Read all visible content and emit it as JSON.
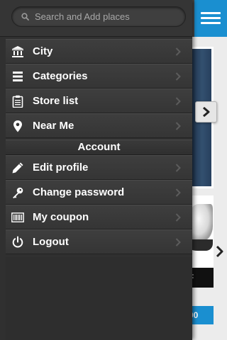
{
  "search": {
    "placeholder": "Search and Add places"
  },
  "menu": {
    "items": [
      {
        "label": "City",
        "icon": "bank-building-icon"
      },
      {
        "label": "Categories",
        "icon": "list-icon"
      },
      {
        "label": "Store list",
        "icon": "clipboard-icon"
      },
      {
        "label": "Near Me",
        "icon": "map-pin-icon"
      }
    ]
  },
  "account": {
    "heading": "Account",
    "items": [
      {
        "label": "Edit profile",
        "icon": "pencil-icon"
      },
      {
        "label": "Change password",
        "icon": "key-icon"
      },
      {
        "label": "My coupon",
        "icon": "barcode-icon"
      },
      {
        "label": "Logout",
        "icon": "power-icon"
      }
    ]
  },
  "background": {
    "card_label": "F",
    "button_label": "00"
  },
  "colors": {
    "accent": "#1a8fd0",
    "drawer_bg": "#303030",
    "row_bg": "#3a3a3a",
    "text": "#ffffff"
  }
}
